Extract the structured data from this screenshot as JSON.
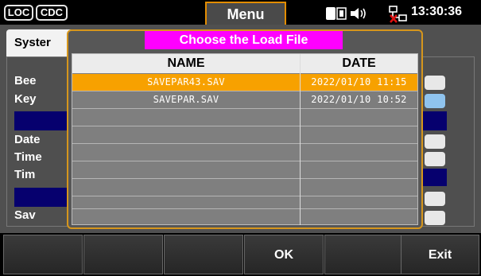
{
  "status_bar": {
    "loc_label": "LOC",
    "cdc_label": "CDC",
    "menu_tab_label": "Menu",
    "time": "13:30:36",
    "icons": [
      "storage-icon",
      "speaker-icon",
      "network-disconnected-icon"
    ]
  },
  "settings_panel": {
    "tab_label": "Syster",
    "labels": [
      "Bee",
      "Key",
      "Date",
      "Time",
      "Tim",
      "Sav"
    ]
  },
  "dialog": {
    "title": "Choose the Load File",
    "columns": [
      "NAME",
      "DATE"
    ],
    "rows": [
      {
        "name": "SAVEPAR43.SAV",
        "date": "2022/01/10 11:15",
        "selected": true
      },
      {
        "name": "SAVEPAR.SAV",
        "date": "2022/01/10 10:52",
        "selected": false
      }
    ]
  },
  "softkeys": [
    "",
    "",
    "",
    "OK",
    "",
    "Exit"
  ],
  "colors": {
    "accent_orange": "#f7a100",
    "dialog_title_bg": "#ff00ff",
    "navy": "#06006e"
  }
}
